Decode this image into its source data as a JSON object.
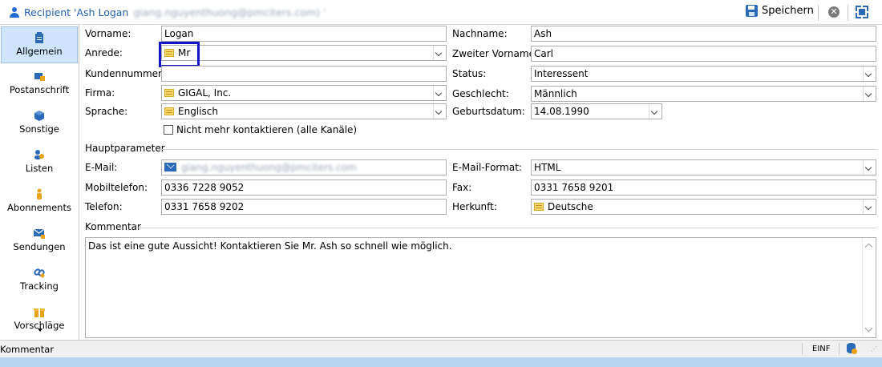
{
  "titlebar": {
    "title": "Recipient 'Ash Logan",
    "blurred_email": "giang.nguyenthuong@pmciters.com) '",
    "save_label": "Speichern"
  },
  "sidebar": {
    "items": [
      {
        "label": "Allgemein",
        "icon": "clipboard-icon",
        "active": true
      },
      {
        "label": "Postanschrift",
        "icon": "mailbox-icon"
      },
      {
        "label": "Sonstige",
        "icon": "cube-icon"
      },
      {
        "label": "Listen",
        "icon": "people-icon"
      },
      {
        "label": "Abonnements",
        "icon": "subscription-icon"
      },
      {
        "label": "Sendungen",
        "icon": "envelope-icon"
      },
      {
        "label": "Tracking",
        "icon": "link-icon"
      },
      {
        "label": "Vorschläge",
        "icon": "gift-icon"
      }
    ]
  },
  "form": {
    "vorname": {
      "label": "Vorname:",
      "value": "Logan"
    },
    "nachname": {
      "label": "Nachname:",
      "value": "Ash"
    },
    "anrede": {
      "label": "Anrede:",
      "value": "Mr"
    },
    "zweiter_vorname": {
      "label": "Zweiter Vorname:",
      "value": "Carl"
    },
    "kundennummer": {
      "label": "Kundennummer:",
      "value": ""
    },
    "status": {
      "label": "Status:",
      "value": "Interessent"
    },
    "firma": {
      "label": "Firma:",
      "value": "GIGAL, Inc."
    },
    "geschlecht": {
      "label": "Geschlecht:",
      "value": "Männlich"
    },
    "sprache": {
      "label": "Sprache:",
      "value": "Englisch"
    },
    "geburtsdatum": {
      "label": "Geburtsdatum:",
      "value": "14.08.1990"
    },
    "nicht_kontaktieren": {
      "label": "Nicht mehr kontaktieren (alle Kanäle)",
      "checked": false
    }
  },
  "hauptparameter": {
    "section_label": "Hauptparameter",
    "email": {
      "label": "E-Mail:",
      "value": "giang.nguyenthuong@pmciters.com"
    },
    "email_format": {
      "label": "E-Mail-Format:",
      "value": "HTML"
    },
    "mobiltelefon": {
      "label": "Mobiltelefon:",
      "value": "0336 7228 9052"
    },
    "fax": {
      "label": "Fax:",
      "value": "0331 7658 9201"
    },
    "telefon": {
      "label": "Telefon:",
      "value": "0331 7658 9202"
    },
    "herkunft": {
      "label": "Herkunft:",
      "value": "Deutsche"
    }
  },
  "kommentar": {
    "section_label": "Kommentar",
    "text": "Das ist eine gute Aussicht! Kontaktieren Sie Mr. Ash so schnell wie möglich."
  },
  "statusbar": {
    "text": "Kommentar",
    "mode": "EINF"
  },
  "colors": {
    "accent": "#1f5fae",
    "highlight_box": "#1414c8",
    "active_nav": "#cde4fa"
  }
}
